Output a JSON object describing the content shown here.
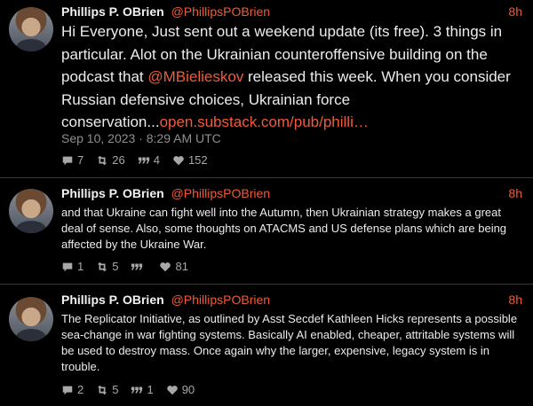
{
  "tweets": [
    {
      "name": "Phillips P. OBrien",
      "handle": "@PhillipsPOBrien",
      "time": "8h",
      "text_a": "Hi Everyone, Just sent out a weekend update (its free). 3 things in particular. Alot on the Ukrainian counteroffensive building on the podcast that ",
      "mention": "@MBielieskov",
      "text_b": " released this week. When you consider Russian defensive choices, Ukrainian force conservation...",
      "link": "open.substack.com/pub/philli…",
      "date": "Sep 10, 2023 · 8:29 AM UTC",
      "stats": {
        "replies": "7",
        "retweets": "26",
        "quotes": "4",
        "likes": "152"
      }
    },
    {
      "name": "Phillips P. OBrien",
      "handle": "@PhillipsPOBrien",
      "time": "8h",
      "text": "and that Ukraine can fight well into the Autumn, then Ukrainian strategy makes a great deal of sense. Also, some thoughts on ATACMS and US defense plans which are being affected by the Ukraine War.",
      "stats": {
        "replies": "1",
        "retweets": "5",
        "quotes": "",
        "likes": "81"
      }
    },
    {
      "name": "Phillips P. OBrien",
      "handle": "@PhillipsPOBrien",
      "time": "8h",
      "text": "The Replicator Initiative, as outlined by Asst Secdef Kathleen Hicks represents a possible sea-change in war fighting systems. Basically AI enabled, cheaper, attritable systems will be used to destroy mass. Once again why the larger, expensive, legacy system is in trouble.",
      "stats": {
        "replies": "2",
        "retweets": "5",
        "quotes": "1",
        "likes": "90"
      }
    }
  ],
  "icons": [
    "reply-icon",
    "retweet-icon",
    "quote-icon",
    "heart-icon"
  ],
  "colors": {
    "accent": "#f05a3a",
    "background": "#000000",
    "text": "#ececec",
    "muted": "#8f8f8f"
  }
}
